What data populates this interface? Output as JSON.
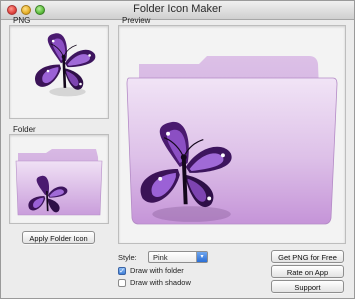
{
  "window": {
    "title": "Folder Icon Maker"
  },
  "panels": {
    "png_label": "PNG",
    "folder_label": "Folder",
    "preview_label": "Preview"
  },
  "buttons": {
    "apply_folder_icon": "Apply Folder Icon",
    "get_png_for_free": "Get PNG for Free",
    "rate_on_app_store": "Rate on App Store",
    "support": "Support"
  },
  "style": {
    "label": "Style:",
    "selected": "Pink"
  },
  "options": {
    "draw_with_folder": {
      "label": "Draw with folder",
      "checked": true
    },
    "draw_with_shadow": {
      "label": "Draw with shadow",
      "checked": false
    }
  },
  "colors": {
    "folder_light": "#e9d6ef",
    "folder_mid": "#cfa6dc",
    "folder_dark": "#b38bc6",
    "butterfly_purple": "#5a1e8a",
    "butterfly_dark": "#1b0b26"
  },
  "icons": [
    "butterfly-icon",
    "folder-icon",
    "checkmark-icon",
    "popup-arrow-icon"
  ]
}
